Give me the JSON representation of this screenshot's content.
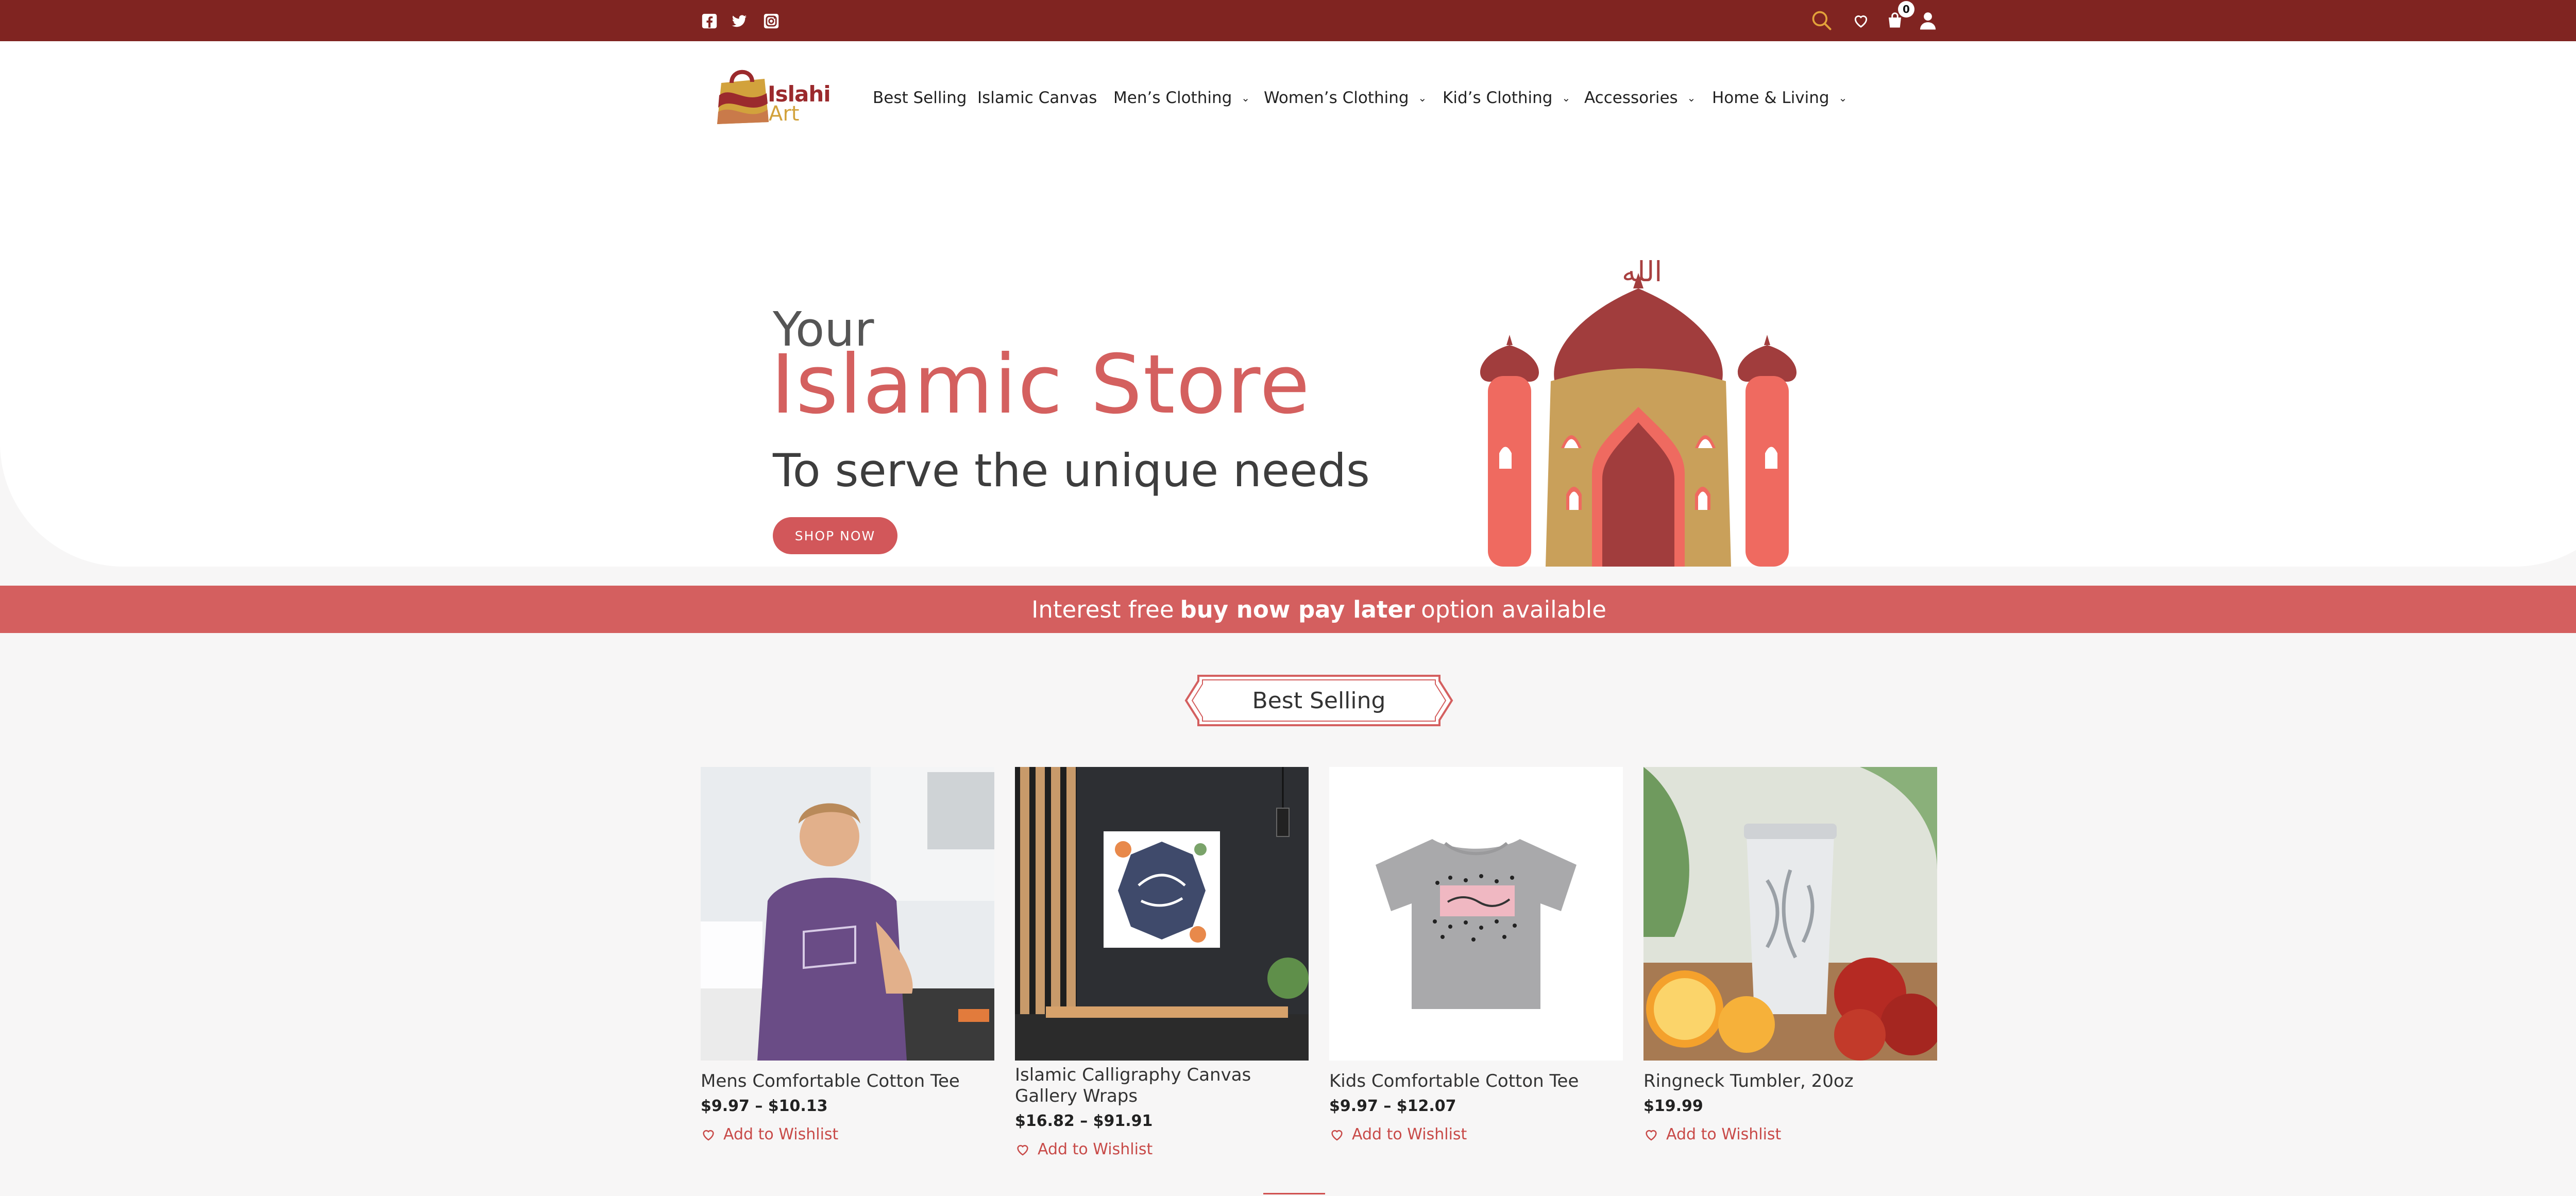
{
  "topbar": {
    "social_icons": [
      "facebook-icon",
      "twitter-icon",
      "instagram-icon"
    ],
    "actions": [
      "search-icon",
      "heart-icon",
      "cart-icon",
      "user-icon"
    ],
    "cart_count": "0"
  },
  "header": {
    "logo_line1": "Islahi",
    "logo_line2": "Art",
    "nav": [
      {
        "label": "Best Selling",
        "has_dropdown": false
      },
      {
        "label": "Islamic Canvas",
        "has_dropdown": false
      },
      {
        "label": "Men’s Clothing",
        "has_dropdown": true
      },
      {
        "label": "Women’s Clothing",
        "has_dropdown": true
      },
      {
        "label": "Kid’s Clothing",
        "has_dropdown": true
      },
      {
        "label": "Accessories",
        "has_dropdown": true
      },
      {
        "label": "Home & Living",
        "has_dropdown": true
      }
    ]
  },
  "hero": {
    "line1": "Your",
    "title": "Islamic Store",
    "subtitle": "To serve the unique needs",
    "button": "SHOP NOW",
    "calligraphy": "الله"
  },
  "banner": {
    "prefix": "Interest free",
    "bold": "buy now pay later",
    "suffix": "option available"
  },
  "section": {
    "title": "Best Selling"
  },
  "products": [
    {
      "name": "Mens Comfortable Cotton Tee",
      "price": "$9.97 – $10.13",
      "wishlist": "Add to Wishlist"
    },
    {
      "name": "Islamic Calligraphy Canvas Gallery Wraps",
      "price": "$16.82 – $91.91",
      "wishlist": "Add to Wishlist"
    },
    {
      "name": "Kids Comfortable Cotton Tee",
      "price": "$9.97 – $12.07",
      "wishlist": "Add to Wishlist"
    },
    {
      "name": "Ringneck Tumbler, 20oz",
      "price": "$19.99",
      "wishlist": "Add to Wishlist"
    }
  ],
  "colors": {
    "topbar": "#802421",
    "accent": "#d45f5f",
    "title": "#d4605f"
  }
}
